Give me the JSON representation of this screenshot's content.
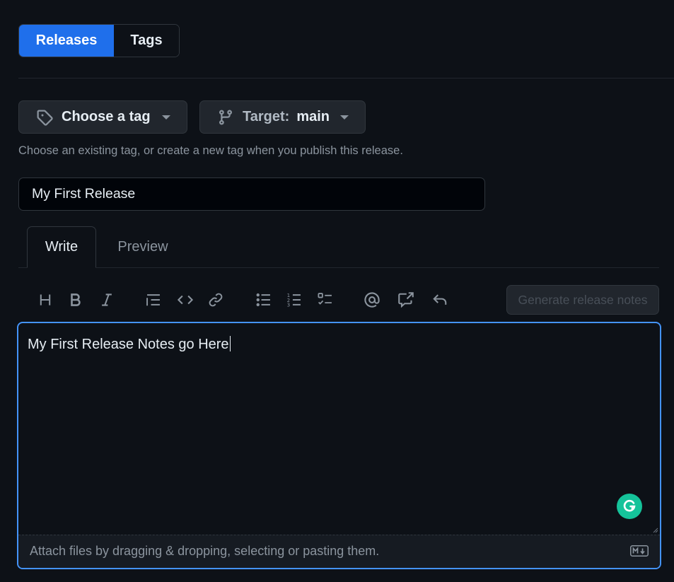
{
  "segmented": {
    "releases": "Releases",
    "tags": "Tags"
  },
  "tag_picker": {
    "label": "Choose a tag",
    "icon": "tag-icon"
  },
  "target_picker": {
    "prefix": "Target:",
    "branch": "main",
    "icon": "git-branch-icon"
  },
  "tag_hint": "Choose an existing tag, or create a new tag when you publish this release.",
  "release_title": {
    "value": "My First Release",
    "placeholder": ""
  },
  "tabs": {
    "write": "Write",
    "preview": "Preview"
  },
  "toolbar": {
    "icons": [
      "heading-icon",
      "bold-icon",
      "italic-icon",
      "quote-icon",
      "code-icon",
      "link-icon",
      "unordered-list-icon",
      "ordered-list-icon",
      "task-list-icon",
      "mention-icon",
      "cross-reference-icon",
      "reply-icon"
    ],
    "generate_label": "Generate release notes"
  },
  "editor": {
    "text": "My First Release Notes go Here",
    "attach_hint": "Attach files by dragging & dropping, selecting or pasting them."
  },
  "colors": {
    "accent": "#1f6feb",
    "focus": "#4493f8",
    "grammarly": "#15c39a"
  }
}
